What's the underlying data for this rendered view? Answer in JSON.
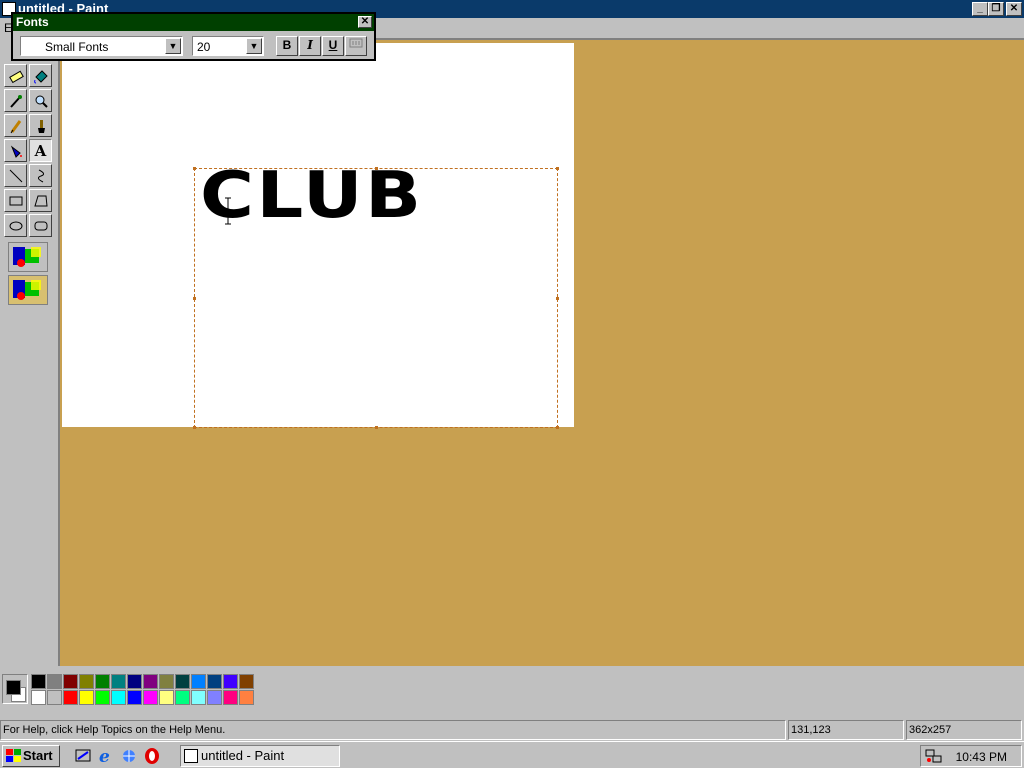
{
  "window": {
    "title": "untitled - Paint",
    "minimize_label": "_",
    "maximize_label": "❐",
    "close_label": "✕"
  },
  "menu": {
    "first_item": "E"
  },
  "fonts_toolbar": {
    "title": "Fonts",
    "close_label": "✕",
    "font_name": "Small Fonts",
    "font_size": "20",
    "bold_label": "B",
    "italic_label": "I",
    "underline_label": "U"
  },
  "canvas": {
    "text": "CLUB"
  },
  "palette": {
    "top_row": [
      "#000000",
      "#808080",
      "#800000",
      "#808000",
      "#008000",
      "#008080",
      "#000080",
      "#800080",
      "#808040",
      "#004040",
      "#0080ff",
      "#004080",
      "#4000ff",
      "#804000"
    ],
    "bottom_row": [
      "#ffffff",
      "#c0c0c0",
      "#ff0000",
      "#ffff00",
      "#00ff00",
      "#00ffff",
      "#0000ff",
      "#ff00ff",
      "#ffff80",
      "#00ff80",
      "#80ffff",
      "#8080ff",
      "#ff0080",
      "#ff8040"
    ],
    "foreground": "#000000",
    "background": "#ffffff"
  },
  "status": {
    "help": "For Help, click Help Topics on the Help Menu.",
    "coords": "131,123",
    "size": "362x257"
  },
  "taskbar": {
    "start_label": "Start",
    "task_label": "untitled - Paint",
    "clock": "10:43 PM"
  },
  "tools": [
    "free-select-icon",
    "select-icon",
    "eraser-icon",
    "fill-icon",
    "color-picker-icon",
    "magnifier-icon",
    "pencil-icon",
    "brush-icon",
    "airbrush-icon",
    "text-icon",
    "line-icon",
    "curve-icon",
    "rectangle-icon",
    "polygon-icon",
    "ellipse-icon",
    "rounded-rectangle-icon"
  ]
}
